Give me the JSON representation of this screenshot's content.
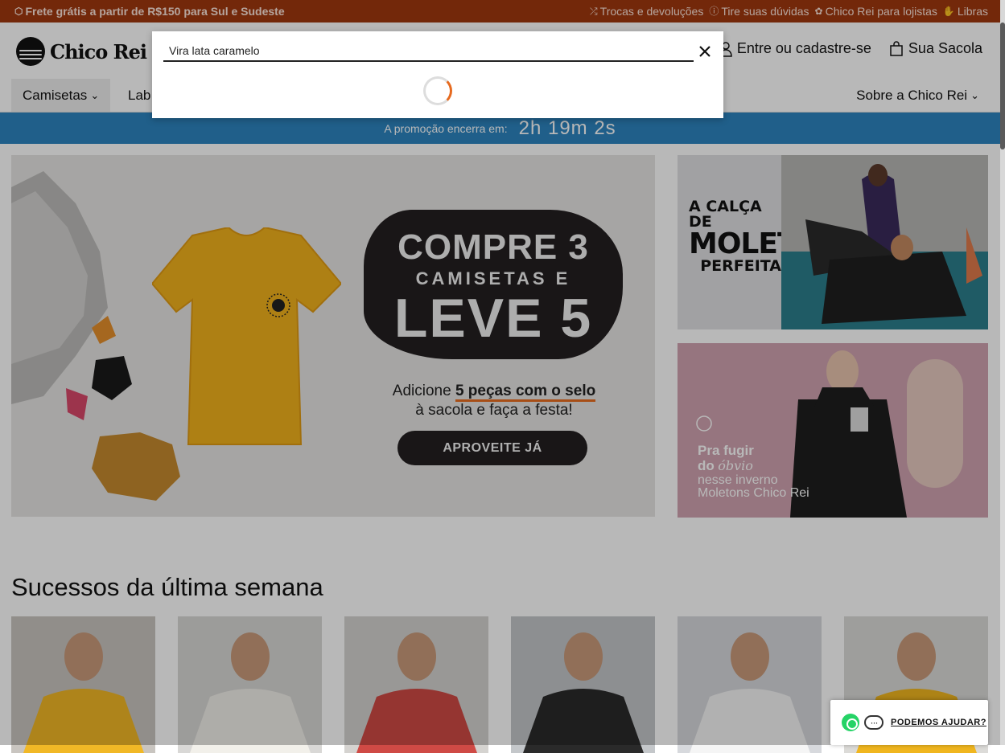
{
  "topbar": {
    "shipping": "Frete grátis a partir de R$150 para Sul e Sudeste",
    "links": [
      "Trocas e devoluções",
      "Tire suas dúvidas",
      "Chico Rei para lojistas",
      "Libras"
    ]
  },
  "header": {
    "logo": "Chico Rei",
    "account": "Entre ou cadastre-se",
    "bag": "Sua Sacola"
  },
  "nav": {
    "items": [
      "Camisetas",
      "Lab",
      "Sobre a Chico Rei"
    ]
  },
  "promo": {
    "label": "A promoção encerra em:",
    "countdown": "2h 19m 2s"
  },
  "hero": {
    "line1": "COMPRE 3",
    "line2": "CAMISETAS E",
    "line3": "LEVE 5",
    "sub1_pre": "Adicione",
    "sub1_bold": "5 peças com o selo",
    "sub2": "à sacola e faça a festa!",
    "cta": "APROVEITE JÁ"
  },
  "side_banner_1": {
    "l1": "A CALÇA DE",
    "l2": "MOLETOM",
    "l3": "PERFEITA"
  },
  "side_banner_2": {
    "l1": "Pra fugir",
    "l2a": "do",
    "l2b": "óbvio",
    "l3": "nesse inverno",
    "l4": "Moletons Chico Rei"
  },
  "section_title": "Sucessos da última semana",
  "search": {
    "value": "Vira lata caramelo"
  },
  "help": {
    "label": "PODEMOS AJUDAR?"
  },
  "colors": {
    "topbar": "#a0380f",
    "promo": "#2d84bf",
    "shirt": "#f2b21c",
    "spinner": "#e66a1f"
  },
  "products": [
    {
      "bg": "#c9c5c0",
      "shirt": "#f1b826"
    },
    {
      "bg": "#d9d8d6",
      "shirt": "#f2f0ea"
    },
    {
      "bg": "#d5d3d0",
      "shirt": "#cf4a45"
    },
    {
      "bg": "#c4c7ca",
      "shirt": "#2a2a2a"
    },
    {
      "bg": "#d7d9dd",
      "shirt": "#f5f5f5"
    },
    {
      "bg": "#dcdbd8",
      "shirt": "#f0b61f"
    }
  ]
}
